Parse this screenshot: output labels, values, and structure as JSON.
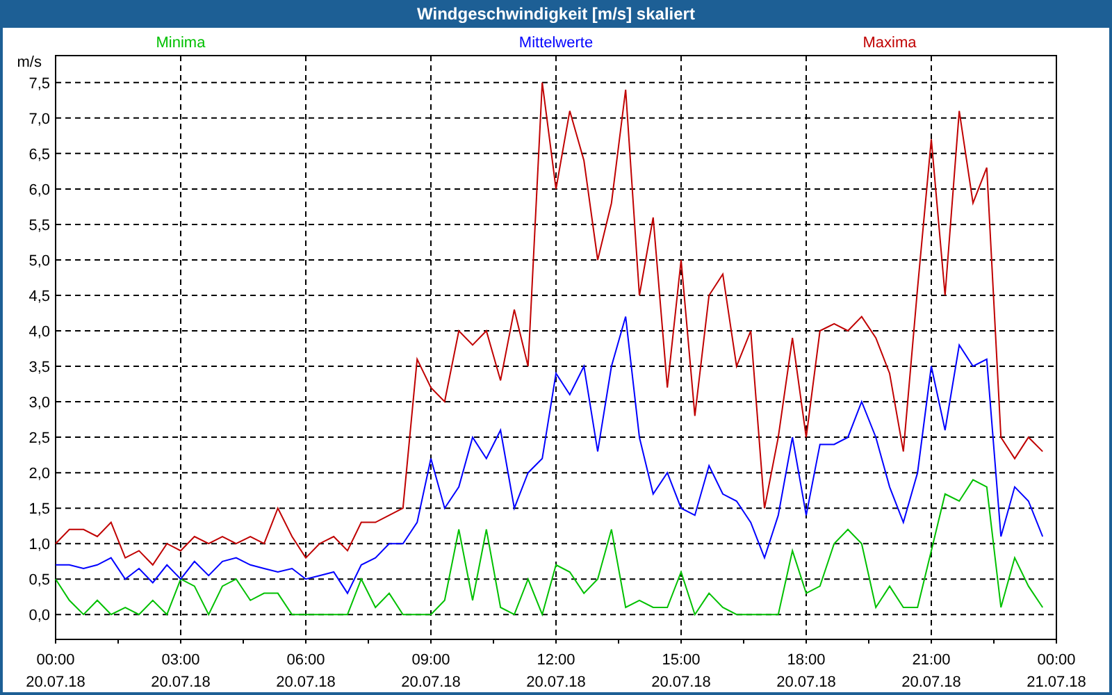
{
  "window": {
    "title": "Windgeschwindigkeit [m/s] skaliert"
  },
  "chart": {
    "chart_data": {
      "type": "line",
      "ylabel": "m/s",
      "x": [
        0,
        0.33,
        0.67,
        1,
        1.33,
        1.67,
        2,
        2.33,
        2.67,
        3,
        3.33,
        3.67,
        4,
        4.33,
        4.67,
        5,
        5.33,
        5.67,
        6,
        6.33,
        6.67,
        7,
        7.33,
        7.67,
        8,
        8.33,
        8.67,
        9,
        9.33,
        9.67,
        10,
        10.33,
        10.67,
        11,
        11.33,
        11.67,
        12,
        12.33,
        12.67,
        13,
        13.33,
        13.67,
        14,
        14.33,
        14.67,
        15,
        15.33,
        15.67,
        16,
        16.33,
        16.67,
        17,
        17.33,
        17.67,
        18,
        18.33,
        18.67,
        19,
        19.33,
        19.67,
        20,
        20.33,
        20.67,
        21,
        21.33,
        21.67,
        22,
        22.33,
        22.67,
        23,
        23.33,
        23.67
      ],
      "series": [
        {
          "name": "Minima",
          "color": "#00c000",
          "values": [
            0.5,
            0.2,
            0.0,
            0.2,
            0.0,
            0.1,
            0.0,
            0.2,
            0.0,
            0.5,
            0.4,
            0.0,
            0.4,
            0.5,
            0.2,
            0.3,
            0.3,
            0.0,
            0.0,
            0.0,
            0.0,
            0.0,
            0.5,
            0.1,
            0.3,
            0.0,
            0.0,
            0.0,
            0.2,
            1.2,
            0.2,
            1.2,
            0.1,
            0.0,
            0.5,
            0.0,
            0.7,
            0.6,
            0.3,
            0.5,
            1.2,
            0.1,
            0.2,
            0.1,
            0.1,
            0.6,
            0.0,
            0.3,
            0.1,
            0.0,
            0.0,
            0.0,
            0.0,
            0.9,
            0.3,
            0.4,
            1.0,
            1.2,
            1.0,
            0.1,
            0.4,
            0.1,
            0.1,
            0.9,
            1.7,
            1.6,
            1.9,
            1.8,
            0.1,
            0.8,
            0.4,
            0.1
          ]
        },
        {
          "name": "Mittelwerte",
          "color": "#0000ff",
          "values": [
            0.7,
            0.7,
            0.65,
            0.7,
            0.8,
            0.5,
            0.65,
            0.45,
            0.7,
            0.5,
            0.75,
            0.55,
            0.75,
            0.8,
            0.7,
            0.65,
            0.6,
            0.65,
            0.5,
            0.55,
            0.6,
            0.3,
            0.7,
            0.8,
            1.0,
            1.0,
            1.3,
            2.2,
            1.5,
            1.8,
            2.5,
            2.2,
            2.6,
            1.5,
            2.0,
            2.2,
            3.4,
            3.1,
            3.5,
            2.3,
            3.5,
            4.2,
            2.5,
            1.7,
            2.0,
            1.5,
            1.4,
            2.1,
            1.7,
            1.6,
            1.3,
            0.8,
            1.4,
            2.5,
            1.4,
            2.4,
            2.4,
            2.5,
            3.0,
            2.5,
            1.8,
            1.3,
            2.0,
            3.5,
            2.6,
            3.8,
            3.5,
            3.6,
            1.1,
            1.8,
            1.6,
            1.1
          ]
        },
        {
          "name": "Maxima",
          "color": "#c00000",
          "values": [
            1.0,
            1.2,
            1.2,
            1.1,
            1.3,
            0.8,
            0.9,
            0.7,
            1.0,
            0.9,
            1.1,
            1.0,
            1.1,
            1.0,
            1.1,
            1.0,
            1.5,
            1.1,
            0.8,
            1.0,
            1.1,
            0.9,
            1.3,
            1.3,
            1.4,
            1.5,
            3.6,
            3.2,
            3.0,
            4.0,
            3.8,
            4.0,
            3.3,
            4.3,
            3.5,
            7.5,
            6.0,
            7.1,
            6.4,
            5.0,
            5.8,
            7.4,
            4.5,
            5.6,
            3.2,
            5.0,
            2.8,
            4.5,
            4.8,
            3.5,
            4.0,
            1.5,
            2.5,
            3.9,
            2.5,
            4.0,
            4.1,
            4.0,
            4.2,
            3.9,
            3.4,
            2.3,
            4.6,
            6.7,
            4.5,
            7.1,
            5.8,
            6.3,
            2.5,
            2.2,
            2.5,
            2.3
          ]
        }
      ],
      "xlim": [
        0,
        24
      ],
      "grid": true,
      "ylim": [
        -0.35,
        7.88
      ],
      "xticks": [
        {
          "value": 0,
          "label": "00:00"
        },
        {
          "value": 3,
          "label": "03:00"
        },
        {
          "value": 6,
          "label": "06:00"
        },
        {
          "value": 9,
          "label": "09:00"
        },
        {
          "value": 12,
          "label": "12:00"
        },
        {
          "value": 15,
          "label": "15:00"
        },
        {
          "value": 18,
          "label": "18:00"
        },
        {
          "value": 21,
          "label": "21:00"
        },
        {
          "value": 24,
          "label": "00:00"
        }
      ],
      "yticks": [
        {
          "value": 0,
          "label": "0,0"
        },
        {
          "value": 0.5,
          "label": "0,5"
        },
        {
          "value": 1,
          "label": "1,0"
        },
        {
          "value": 1.5,
          "label": "1,5"
        },
        {
          "value": 2,
          "label": "2,0"
        },
        {
          "value": 2.5,
          "label": "2,5"
        },
        {
          "value": 3,
          "label": "3,0"
        },
        {
          "value": 3.5,
          "label": "3,5"
        },
        {
          "value": 4,
          "label": "4,0"
        },
        {
          "value": 4.5,
          "label": "4,5"
        },
        {
          "value": 5,
          "label": "5,0"
        },
        {
          "value": 5.5,
          "label": "5,5"
        },
        {
          "value": 6,
          "label": "6,0"
        },
        {
          "value": 6.5,
          "label": "6,5"
        },
        {
          "value": 7,
          "label": "7,0"
        },
        {
          "value": 7.5,
          "label": "7,5"
        }
      ]
    },
    "x_axis_dates": [
      "20.07.18",
      "20.07.18",
      "20.07.18",
      "20.07.18",
      "20.07.18",
      "20.07.18",
      "20.07.18",
      "20.07.18",
      "21.07.18"
    ]
  }
}
